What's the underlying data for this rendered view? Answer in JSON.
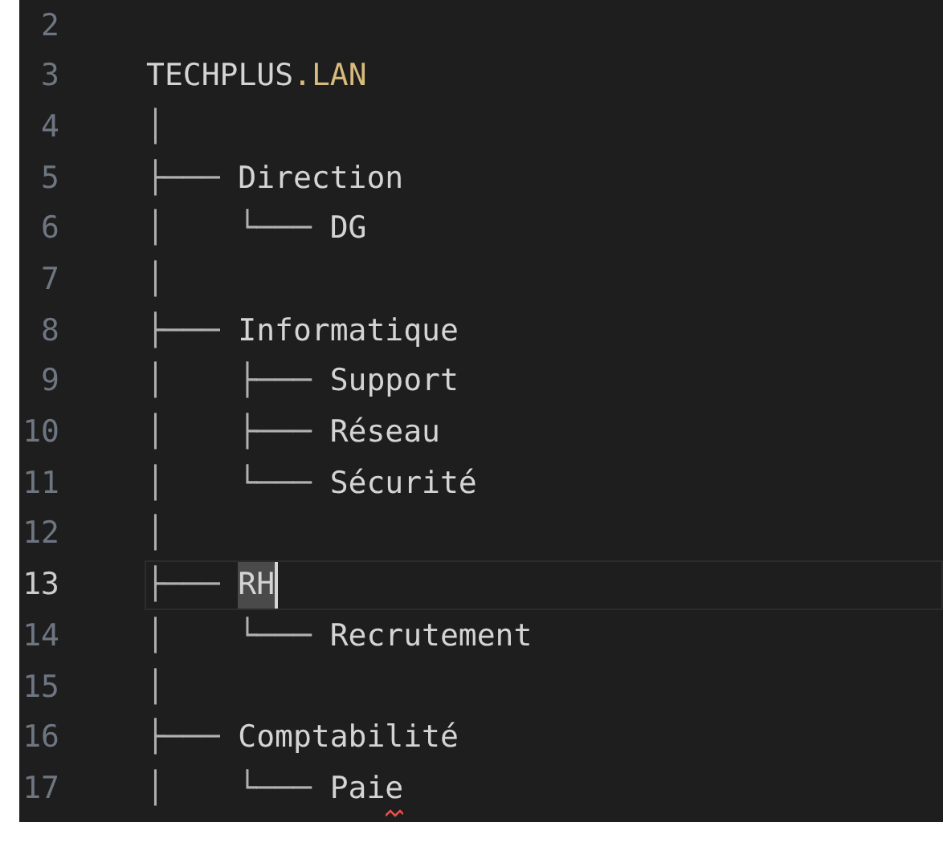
{
  "editor": {
    "lines": [
      {
        "number": "2",
        "current": false
      },
      {
        "number": "3",
        "current": false,
        "label": "TECHPLUS",
        "suffix": ".LAN"
      },
      {
        "number": "4",
        "current": false,
        "tree": "│"
      },
      {
        "number": "5",
        "current": false,
        "tree": "├───",
        "label": "Direction"
      },
      {
        "number": "6",
        "current": false,
        "tree": "│    └───",
        "label": "DG"
      },
      {
        "number": "7",
        "current": false,
        "tree": "│"
      },
      {
        "number": "8",
        "current": false,
        "tree": "├───",
        "label": "Informatique"
      },
      {
        "number": "9",
        "current": false,
        "tree": "│    ├───",
        "label": "Support"
      },
      {
        "number": "10",
        "current": false,
        "tree": "│    ├───",
        "label": "Réseau"
      },
      {
        "number": "11",
        "current": false,
        "tree": "│    └───",
        "label": "Sécurité"
      },
      {
        "number": "12",
        "current": false,
        "tree": "│"
      },
      {
        "number": "13",
        "current": true,
        "tree": "├───",
        "label": "RH",
        "label_selected": true
      },
      {
        "number": "14",
        "current": false,
        "tree": "│    └───",
        "label": "Recrutement"
      },
      {
        "number": "15",
        "current": false,
        "tree": "│"
      },
      {
        "number": "16",
        "current": false,
        "tree": "├───",
        "label": "Comptabilité"
      },
      {
        "number": "17",
        "current": false,
        "tree": "│    └───",
        "label": "Paie",
        "spelling_error": true
      }
    ]
  }
}
